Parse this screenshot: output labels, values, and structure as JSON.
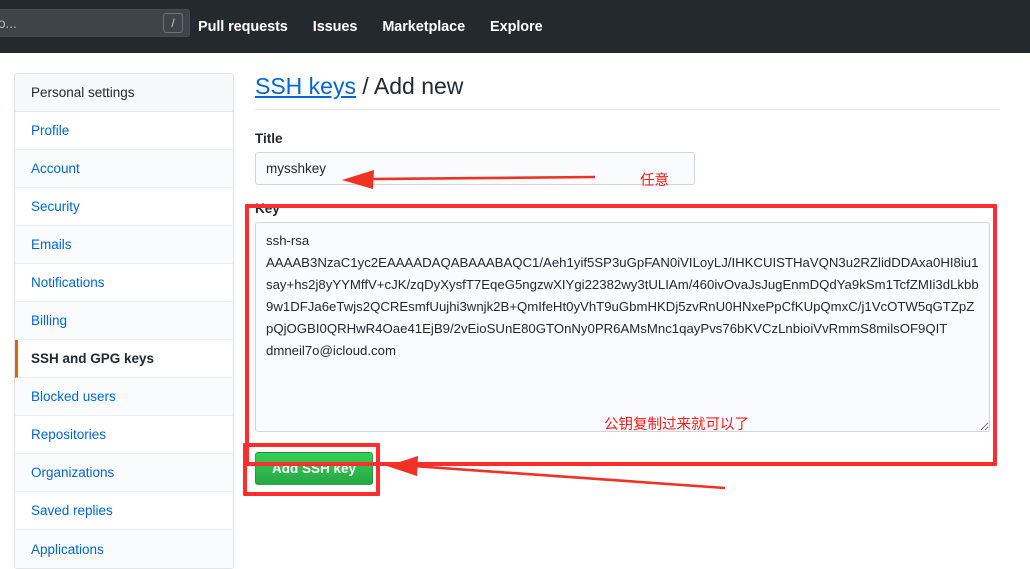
{
  "topnav": {
    "search_placeholder": "Search or jump to...",
    "search_value": "",
    "slash_hint": "/",
    "links": [
      {
        "label": "Pull requests"
      },
      {
        "label": "Issues"
      },
      {
        "label": "Marketplace"
      },
      {
        "label": "Explore"
      }
    ]
  },
  "sidebar": {
    "heading": "Personal settings",
    "items": [
      {
        "label": "Profile",
        "selected": false
      },
      {
        "label": "Account",
        "selected": false
      },
      {
        "label": "Security",
        "selected": false
      },
      {
        "label": "Emails",
        "selected": false
      },
      {
        "label": "Notifications",
        "selected": false
      },
      {
        "label": "Billing",
        "selected": false
      },
      {
        "label": "SSH and GPG keys",
        "selected": true
      },
      {
        "label": "Blocked users",
        "selected": false
      },
      {
        "label": "Repositories",
        "selected": false
      },
      {
        "label": "Organizations",
        "selected": false
      },
      {
        "label": "Saved replies",
        "selected": false
      },
      {
        "label": "Applications",
        "selected": false
      }
    ]
  },
  "main": {
    "title_link": "SSH keys",
    "title_rest": "/ Add new",
    "title_label": "Title",
    "title_value": "mysshkey",
    "title_placeholder": "",
    "key_label": "Key",
    "key_value": "ssh-rsa\nAAAAB3NzaC1yc2EAAAADAQABAAABAQC1/Aeh1yif5SP3uGpFAN0iVILoyLJ/IHKCUISTHaVQN3u2RZlidDDAxa0HI8iu1say+hs2j8yYYMffV+cJK/zqDyXysfT7EqeG5ngzwXIYgi22382wy3tULIAm/460ivOvaJsJugEnmDQdYa9kSm1TcfZMIi3dLkbb9w1DFJa6eTwjs2QCREsmfUujhi3wnjk2B+QmIfeHt0yVhT9uGbmHKDj5zvRnU0HNxePpCfKUpQmxC/j1VcOTW5qGTZpZpQjOGBI0QRHwR4Oae41EjB9/2vEioSUnE80GTOnNy0PR6AMsMnc1qayPvs76bKVCzLnbioiVvRmmS8milsOF9QIT\ndmneil7o@icloud.com",
    "submit_label": "Add SSH key"
  },
  "annotations": {
    "title_note": "任意",
    "key_note": "公钥复制过来就可以了",
    "accent_color": "#ff2d2d"
  }
}
